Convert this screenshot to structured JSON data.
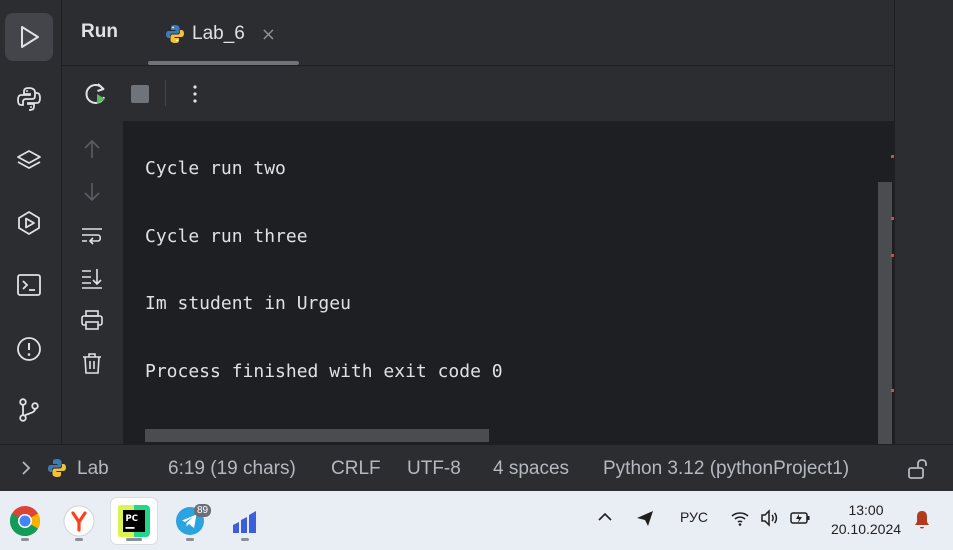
{
  "run_panel": {
    "title": "Run",
    "tab": {
      "label": "Lab_6",
      "close_glyph": "×"
    }
  },
  "console": {
    "lines": [
      "Cycle run two",
      "Cycle run three",
      "Im student in Urgeu",
      "Process finished with exit code 0"
    ]
  },
  "status_bar": {
    "breadcrumb": "Lab",
    "position": "6:19 (19 chars)",
    "line_separator": "CRLF",
    "encoding": "UTF-8",
    "indent": "4 spaces",
    "interpreter": "Python 3.12 (pythonProject1)"
  },
  "taskbar": {
    "telegram_badge": "89",
    "language": "РУС",
    "time": "13:00",
    "date": "20.10.2024"
  },
  "icons": {
    "activity": [
      "run-icon",
      "python-console-icon",
      "layers-icon",
      "services-icon",
      "terminal-icon",
      "problems-icon",
      "git-icon"
    ],
    "toolbar": [
      "rerun-icon",
      "stop-icon",
      "more-icon"
    ],
    "gutter": [
      "arrow-up-icon",
      "arrow-down-icon",
      "soft-wrap-icon",
      "scroll-to-end-icon",
      "print-icon",
      "trash-icon"
    ]
  },
  "colors": {
    "background": "#1e1f22",
    "panel": "#2b2d30",
    "text": "#dfe1e5",
    "muted": "#8c8f94",
    "run_green": "#5fb865"
  }
}
